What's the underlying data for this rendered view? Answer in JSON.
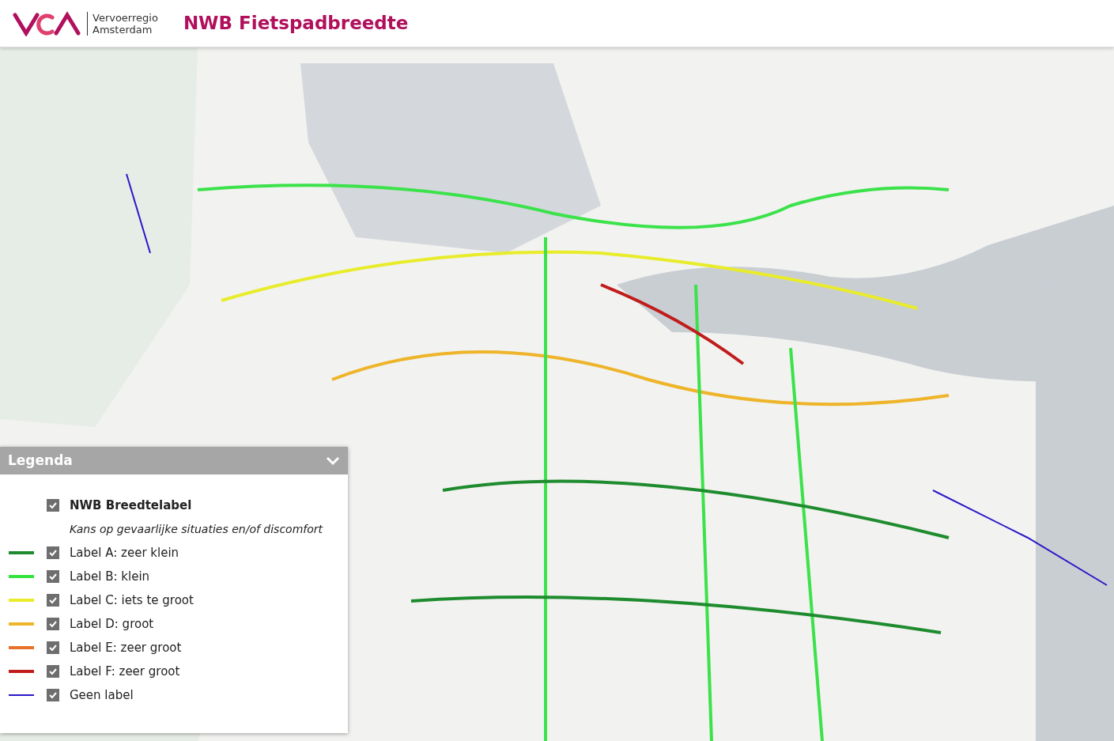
{
  "header": {
    "org_name": [
      "Vervoerregio",
      "Amsterdam"
    ],
    "title": "NWB Fietspadbreedte"
  },
  "legend": {
    "title": "Legenda",
    "expanded": true,
    "group": {
      "label": "NWB Breedtelabel",
      "checked": true,
      "subtitle": "Kans op gevaarlijke situaties en/of discomfort"
    },
    "items": [
      {
        "label": "Label A: zeer klein",
        "checked": true,
        "color": "#1e8c2e",
        "kind": "thick"
      },
      {
        "label": "Label B: klein",
        "checked": true,
        "color": "#33e43c",
        "kind": "thick"
      },
      {
        "label": "Label C: iets te groot",
        "checked": true,
        "color": "#e8ec2a",
        "kind": "thick"
      },
      {
        "label": "Label D: groot",
        "checked": true,
        "color": "#eeb42a",
        "kind": "thick"
      },
      {
        "label": "Label E: zeer groot",
        "checked": true,
        "color": "#e8702a",
        "kind": "thick"
      },
      {
        "label": "Label F: zeer groot",
        "checked": true,
        "color": "#c01c1c",
        "kind": "thick"
      },
      {
        "label": "Geen label",
        "checked": true,
        "color": "#2a18c8",
        "kind": "thin"
      }
    ]
  }
}
